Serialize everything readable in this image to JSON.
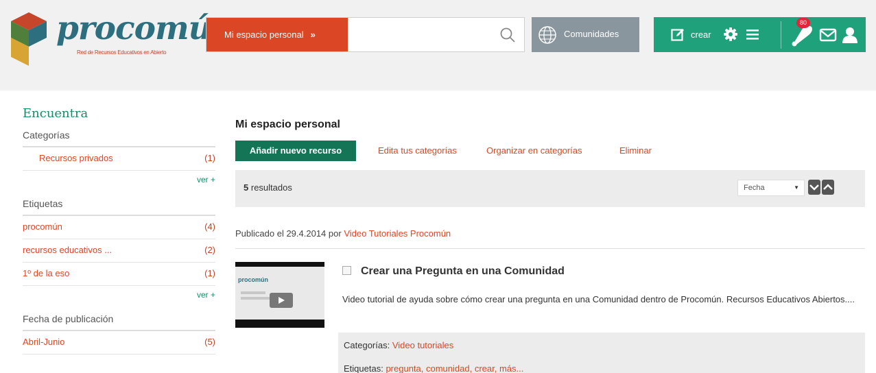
{
  "header": {
    "logo_word": "procomún",
    "logo_tagline": "Red de Recursos Educativos en Abierto",
    "search_scope": "Mi espacio personal",
    "search_scope_chevron": "»",
    "communities_label": "Comunidades",
    "create_label": "crear",
    "notifications_count": "80",
    "colors": {
      "search_red": "#db4625",
      "communities_gray": "#8a969d",
      "tools_green": "#1fa27c"
    },
    "icons": [
      "search-icon",
      "globe-icon",
      "edit-icon",
      "gear-icon",
      "menu-icon",
      "bell-icon",
      "mail-icon",
      "user-icon"
    ]
  },
  "sidebar": {
    "title": "Encuentra",
    "categories": {
      "heading": "Categorías",
      "items": [
        {
          "label": "Recursos privados",
          "count": "(1)"
        }
      ],
      "more": "ver +"
    },
    "tags": {
      "heading": "Etiquetas",
      "items": [
        {
          "label": "procomún",
          "count": "(4)"
        },
        {
          "label": "recursos educativos ...",
          "count": "(2)"
        },
        {
          "label": "1º de la eso",
          "count": "(1)"
        }
      ],
      "more": "ver +"
    },
    "dates": {
      "heading": "Fecha de publicación",
      "items": [
        {
          "label": "Abril-Junio",
          "count": "(5)"
        }
      ]
    }
  },
  "main": {
    "title": "Mi espacio personal",
    "add_button": "Añadir nuevo recurso",
    "links": [
      "Edita tus categorías",
      "Organizar en categorías",
      "Eliminar"
    ],
    "results_count": "5",
    "results_label": "resultados",
    "sort_value": "Fecha",
    "item": {
      "published_prefix": "Publicado el 29.4.2014 por",
      "author": "Video Tutoriales Procomún",
      "title": "Crear una Pregunta en una Comunidad",
      "description": "Video tutorial de ayuda sobre cómo crear una pregunta en una Comunidad dentro de Procomún. Recursos Educativos Abiertos....",
      "thumb_logo": "procomún",
      "categories_label": "Categorías:",
      "categories_value": "Video tutoriales",
      "tags_label": "Etiquetas:",
      "tags_value": "pregunta, comunidad, crear, más..."
    }
  }
}
